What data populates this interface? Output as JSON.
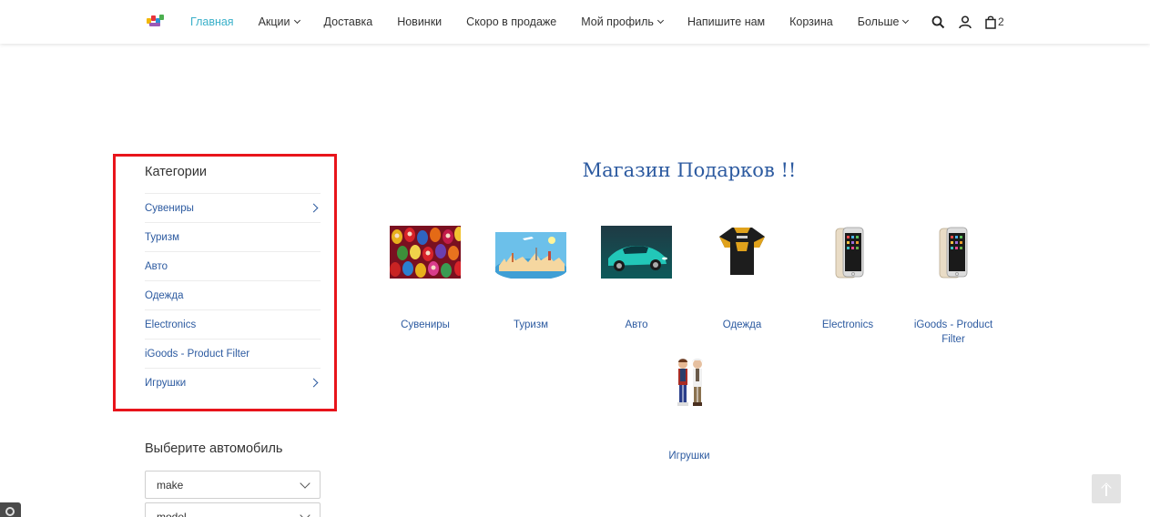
{
  "header": {
    "nav": [
      {
        "label": "Главная",
        "active": true,
        "dropdown": false
      },
      {
        "label": "Акции",
        "active": false,
        "dropdown": true
      },
      {
        "label": "Доставка",
        "active": false,
        "dropdown": false
      },
      {
        "label": "Новинки",
        "active": false,
        "dropdown": false
      },
      {
        "label": "Скоро в продаже",
        "active": false,
        "dropdown": false
      },
      {
        "label": "Мой профиль",
        "active": false,
        "dropdown": true
      },
      {
        "label": "Напишите нам",
        "active": false,
        "dropdown": false
      },
      {
        "label": "Корзина",
        "active": false,
        "dropdown": false
      },
      {
        "label": "Больше",
        "active": false,
        "dropdown": true
      }
    ],
    "cart_count": "2",
    "icons": [
      "search-icon",
      "user-icon",
      "cart-icon"
    ]
  },
  "sidebar": {
    "categories_title": "Категории",
    "categories": [
      {
        "label": "Сувениры",
        "has_children": true
      },
      {
        "label": "Туризм",
        "has_children": false
      },
      {
        "label": "Авто",
        "has_children": false
      },
      {
        "label": "Одежда",
        "has_children": false
      },
      {
        "label": "Electronics",
        "has_children": false
      },
      {
        "label": "iGoods - Product Filter",
        "has_children": false
      },
      {
        "label": "Игрушки",
        "has_children": true
      }
    ],
    "car_title": "Выберите автомобиль",
    "selects": [
      "make",
      "model"
    ]
  },
  "main": {
    "title": "Магазин Подарков !!",
    "products": [
      {
        "label": "Сувениры",
        "image": "matryoshka-dolls"
      },
      {
        "label": "Туризм",
        "image": "world-travel"
      },
      {
        "label": "Авто",
        "image": "sports-car"
      },
      {
        "label": "Одежда",
        "image": "cycling-jersey"
      },
      {
        "label": "Electronics",
        "image": "smartphones"
      },
      {
        "label": "iGoods - Product Filter",
        "image": "smartphones"
      },
      {
        "label": "Игрушки",
        "image": "toy-figures"
      }
    ]
  },
  "colors": {
    "accent": "#3ab0c9",
    "link": "#2c5aa0",
    "highlight_box": "#e8141b"
  }
}
